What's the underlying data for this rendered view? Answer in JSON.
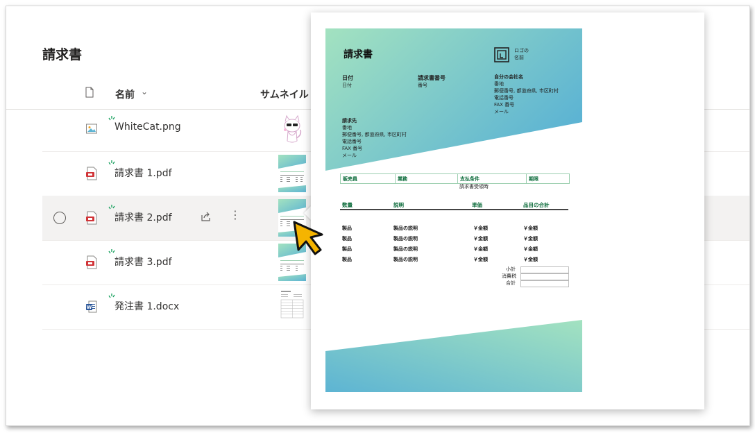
{
  "page": {
    "title": "請求書"
  },
  "columns": {
    "name": "名前",
    "thumbnail": "サムネイル"
  },
  "files": [
    {
      "name": "WhiteCat.png",
      "type": "image"
    },
    {
      "name": "請求書 1.pdf",
      "type": "pdf"
    },
    {
      "name": "請求書 2.pdf",
      "type": "pdf",
      "selected": true
    },
    {
      "name": "請求書 3.pdf",
      "type": "pdf"
    },
    {
      "name": "発注書 1.docx",
      "type": "word"
    }
  ],
  "preview": {
    "title": "請求書",
    "logo_text_1": "ロゴの",
    "logo_text_2": "名前",
    "date_label": "日付",
    "date_value": "日付",
    "invoice_no_label": "請求書番号",
    "invoice_no_value": "番号",
    "company_label": "自分の会社名",
    "company_lines": [
      "番地",
      "郵便番号, 都道府県, 市区町村",
      "電話番号",
      "FAX 番号",
      "メール"
    ],
    "billto_label": "請求先",
    "billto_lines": [
      "番地",
      "郵便番号, 都道府県, 市区町村",
      "電話番号",
      "FAX 番号",
      "メール"
    ],
    "info_headers": [
      "販売員",
      "業務",
      "支払条件",
      "期限"
    ],
    "payment_terms": "請求書受領時",
    "item_headers": [
      "数量",
      "説明",
      "単価",
      "品目の合計"
    ],
    "items": [
      {
        "qty": "製品",
        "desc": "製品の説明",
        "price": "￥金額",
        "total": "￥金額"
      },
      {
        "qty": "製品",
        "desc": "製品の説明",
        "price": "￥金額",
        "total": "￥金額"
      },
      {
        "qty": "製品",
        "desc": "製品の説明",
        "price": "￥金額",
        "total": "￥金額"
      },
      {
        "qty": "製品",
        "desc": "製品の説明",
        "price": "￥金額",
        "total": "￥金額"
      }
    ],
    "subtotal_label": "小計",
    "tax_label": "消費税",
    "total_label": "合計"
  },
  "colors": {
    "accent_green": "#a3e2c0",
    "accent_blue": "#5db4d3",
    "pdf_red": "#d13438",
    "word_blue": "#2b579a",
    "new_mark": "#0f9d58"
  }
}
